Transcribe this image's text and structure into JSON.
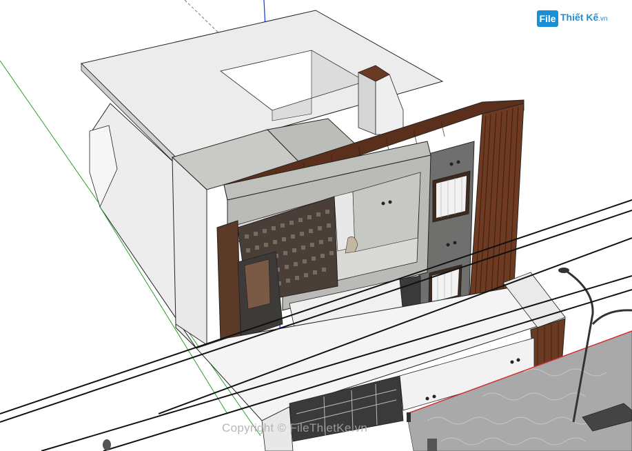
{
  "scene": {
    "description_colors": {
      "background": "#ffffff",
      "concrete": "#b9bab6",
      "wood": "#6a3a22",
      "axis_blue": "#1f3fff",
      "axis_green": "#2aa02a"
    }
  },
  "logo": {
    "badge": "File",
    "brand": "Thiết Kế",
    "domain": ".vn"
  },
  "watermark": {
    "text": "Copyright © FileThietKe.vn"
  }
}
